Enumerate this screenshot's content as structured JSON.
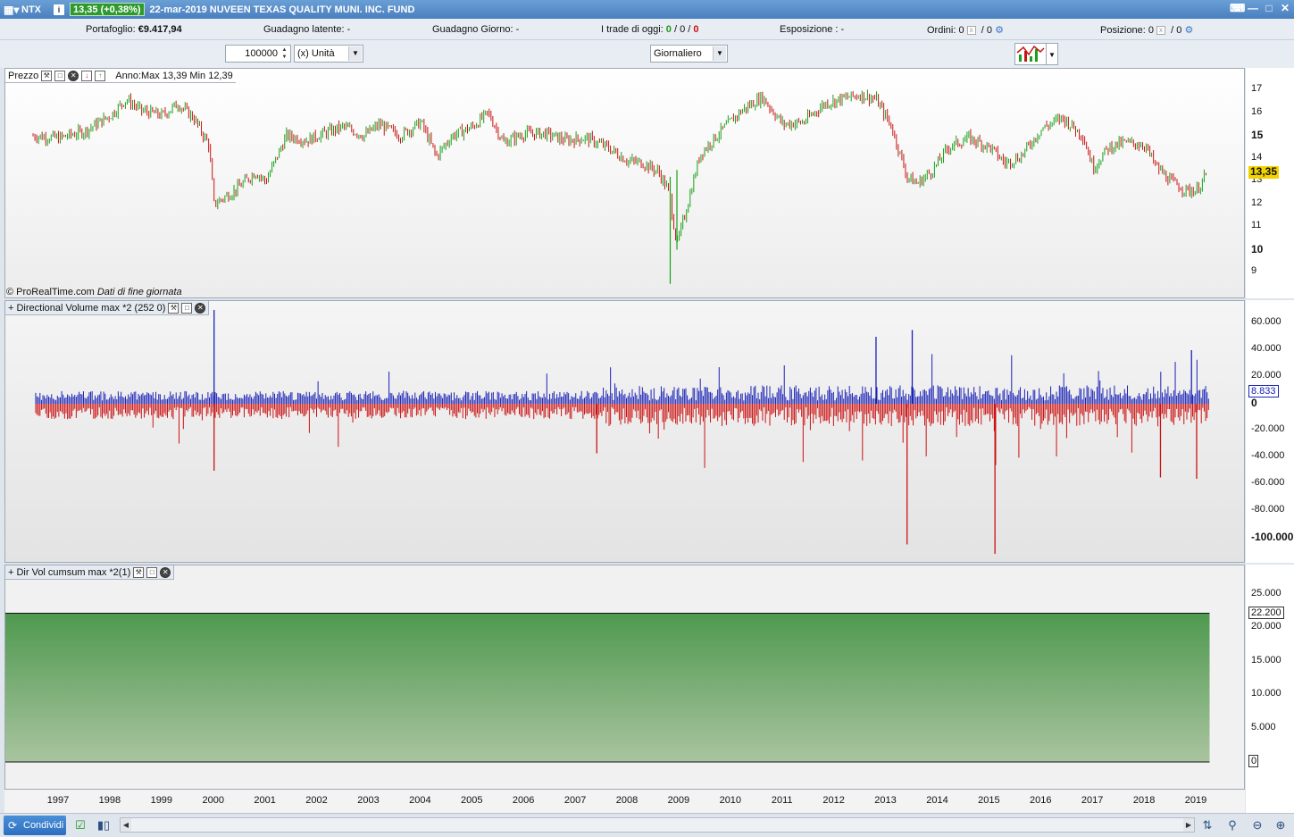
{
  "titlebar": {
    "symbol": "NTX",
    "price_change": "13,35 (+0,38%)",
    "description": "22-mar-2019 NUVEEN TEXAS QUALITY MUNI. INC. FUND",
    "icons": [
      "chart-app-icon",
      "info-icon",
      "keyboard-icon",
      "minimize-icon",
      "maximize-icon",
      "close-icon"
    ]
  },
  "portfolio_bar": {
    "portfolio_label": "Portafoglio:",
    "portfolio_value": "€9.417,94",
    "latent_label": "Guadagno latente:",
    "latent_value": "-",
    "day_gain_label": "Guadagno Giorno:",
    "day_gain_value": "-",
    "trades_label": "I trade di oggi:",
    "trades_a": "0",
    "trades_b": "0",
    "trades_c": "0",
    "exposure_label": "Esposizione :",
    "exposure_value": "-",
    "orders_label": "Ordini:",
    "orders_a": "0",
    "orders_b": "0",
    "position_label": "Posizione:",
    "position_a": "0",
    "position_b": "0"
  },
  "controls": {
    "quantity": "100000",
    "unit": "(x) Unità",
    "timeframe": "Giornaliero"
  },
  "price_panel": {
    "title": "Prezzo",
    "note": "Anno:Max 13,39 Min 12,39",
    "watermark": "© ProRealTime.com",
    "watermark_note": "Dati di fine giornata",
    "last_value": "13,35",
    "ticks": [
      "17",
      "16",
      "15",
      "14",
      "13",
      "12",
      "11",
      "10",
      "9"
    ]
  },
  "volume_panel": {
    "title": "+ Directional Volume max *2 (252 0)",
    "last_value": "8.833",
    "ticks": [
      "60.000",
      "40.000",
      "20.000",
      "0",
      "-20.000",
      "-40.000",
      "-60.000",
      "-80.000",
      "-100.000"
    ]
  },
  "cumsum_panel": {
    "title": "+ Dir Vol cumsum max *2(1)",
    "last_value": "22.200",
    "ticks": [
      "25.000",
      "20.000",
      "15.000",
      "10.000",
      "5.000",
      "0"
    ]
  },
  "x_axis": {
    "years": [
      "1997",
      "1998",
      "1999",
      "2000",
      "2001",
      "2002",
      "2003",
      "2004",
      "2005",
      "2006",
      "2007",
      "2008",
      "2009",
      "2010",
      "2011",
      "2012",
      "2013",
      "2014",
      "2015",
      "2016",
      "2017",
      "2018",
      "2019"
    ]
  },
  "bottom_bar": {
    "share_label": "Condividi"
  },
  "chart_data": [
    {
      "type": "line",
      "series": [
        {
          "x": [
            1996.5,
            1997.0,
            1997.5,
            1998.0,
            1998.3,
            1998.6,
            1999.0,
            1999.3,
            1999.6,
            1999.9,
            2000.0,
            2000.4,
            2000.8,
            2001.0,
            2001.4,
            2001.8,
            2002.0,
            2002.5,
            2002.9,
            2003.2,
            2003.6,
            2004.0,
            2004.3,
            2004.6,
            2005.0,
            2005.3,
            2005.6,
            2006.0,
            2006.4,
            2006.8,
            2007.2,
            2007.6,
            2008.0,
            2008.3,
            2008.6,
            2008.8,
            2008.95,
            2009.1,
            2009.4,
            2009.8,
            2010.2,
            2010.6,
            2011.0,
            2011.4,
            2011.8,
            2012.1,
            2012.5,
            2012.8,
            2013.1,
            2013.4,
            2013.6,
            2013.9,
            2014.2,
            2014.6,
            2015.0,
            2015.3,
            2015.6,
            2016.0,
            2016.4,
            2016.8,
            2017.0,
            2017.3,
            2017.6,
            2018.0,
            2018.2,
            2018.5,
            2018.8,
            2019.0,
            2019.2
          ],
          "values": [
            15.0,
            14.9,
            15.2,
            15.9,
            16.6,
            16.1,
            15.9,
            16.4,
            15.8,
            14.6,
            12.0,
            12.6,
            13.4,
            13.0,
            15.0,
            14.8,
            15.0,
            15.4,
            15.0,
            15.5,
            15.0,
            15.6,
            14.1,
            15.0,
            15.4,
            16.0,
            14.7,
            15.1,
            15.1,
            14.8,
            14.9,
            14.5,
            13.9,
            13.8,
            13.4,
            12.5,
            10.2,
            11.5,
            14.2,
            15.2,
            16.1,
            16.7,
            15.5,
            15.6,
            16.4,
            16.6,
            16.8,
            16.6,
            15.4,
            13.2,
            12.9,
            13.5,
            14.5,
            14.9,
            14.5,
            13.8,
            14.1,
            15.3,
            15.8,
            15.0,
            13.6,
            14.5,
            14.7,
            14.6,
            13.7,
            13.0,
            12.6,
            12.6,
            13.35
          ],
          "low": 8.5
        }
      ],
      "ylim": [
        8.5,
        17.5
      ]
    },
    {
      "type": "bar",
      "series": [
        {
          "values_desc": "positive blue bars",
          "peak_values": [
            {
              "x": 2000.0,
              "value": 70000
            },
            {
              "x": 2013.5,
              "value": 55000
            },
            {
              "x": 2012.8,
              "value": 50000
            },
            {
              "x": 2018.9,
              "value": 40000
            }
          ]
        },
        {
          "values_desc": "negative red bars",
          "peak_values": [
            {
              "x": 2000.0,
              "value": -50000
            },
            {
              "x": 2013.4,
              "value": -105000
            },
            {
              "x": 2015.1,
              "value": -112000
            },
            {
              "x": 2007.4,
              "value": -37000
            },
            {
              "x": 2018.3,
              "value": -55000
            },
            {
              "x": 2019.0,
              "value": -56000
            }
          ]
        }
      ],
      "last_value": 8833,
      "ylim": [
        -115000,
        70000
      ]
    },
    {
      "type": "area",
      "series": [
        {
          "x": [
            1996.55,
            2019.25
          ],
          "values": [
            22200,
            22200
          ]
        }
      ],
      "ylim": [
        -2000,
        30000
      ]
    }
  ],
  "colors": {
    "up": "#18a018",
    "down": "#c81414",
    "volume_up": "#1a22b5",
    "volume_down": "#cc1111",
    "area_top": "#4f994f",
    "area_bottom": "#a9c4a0",
    "last_price_bg": "#f2d300"
  }
}
